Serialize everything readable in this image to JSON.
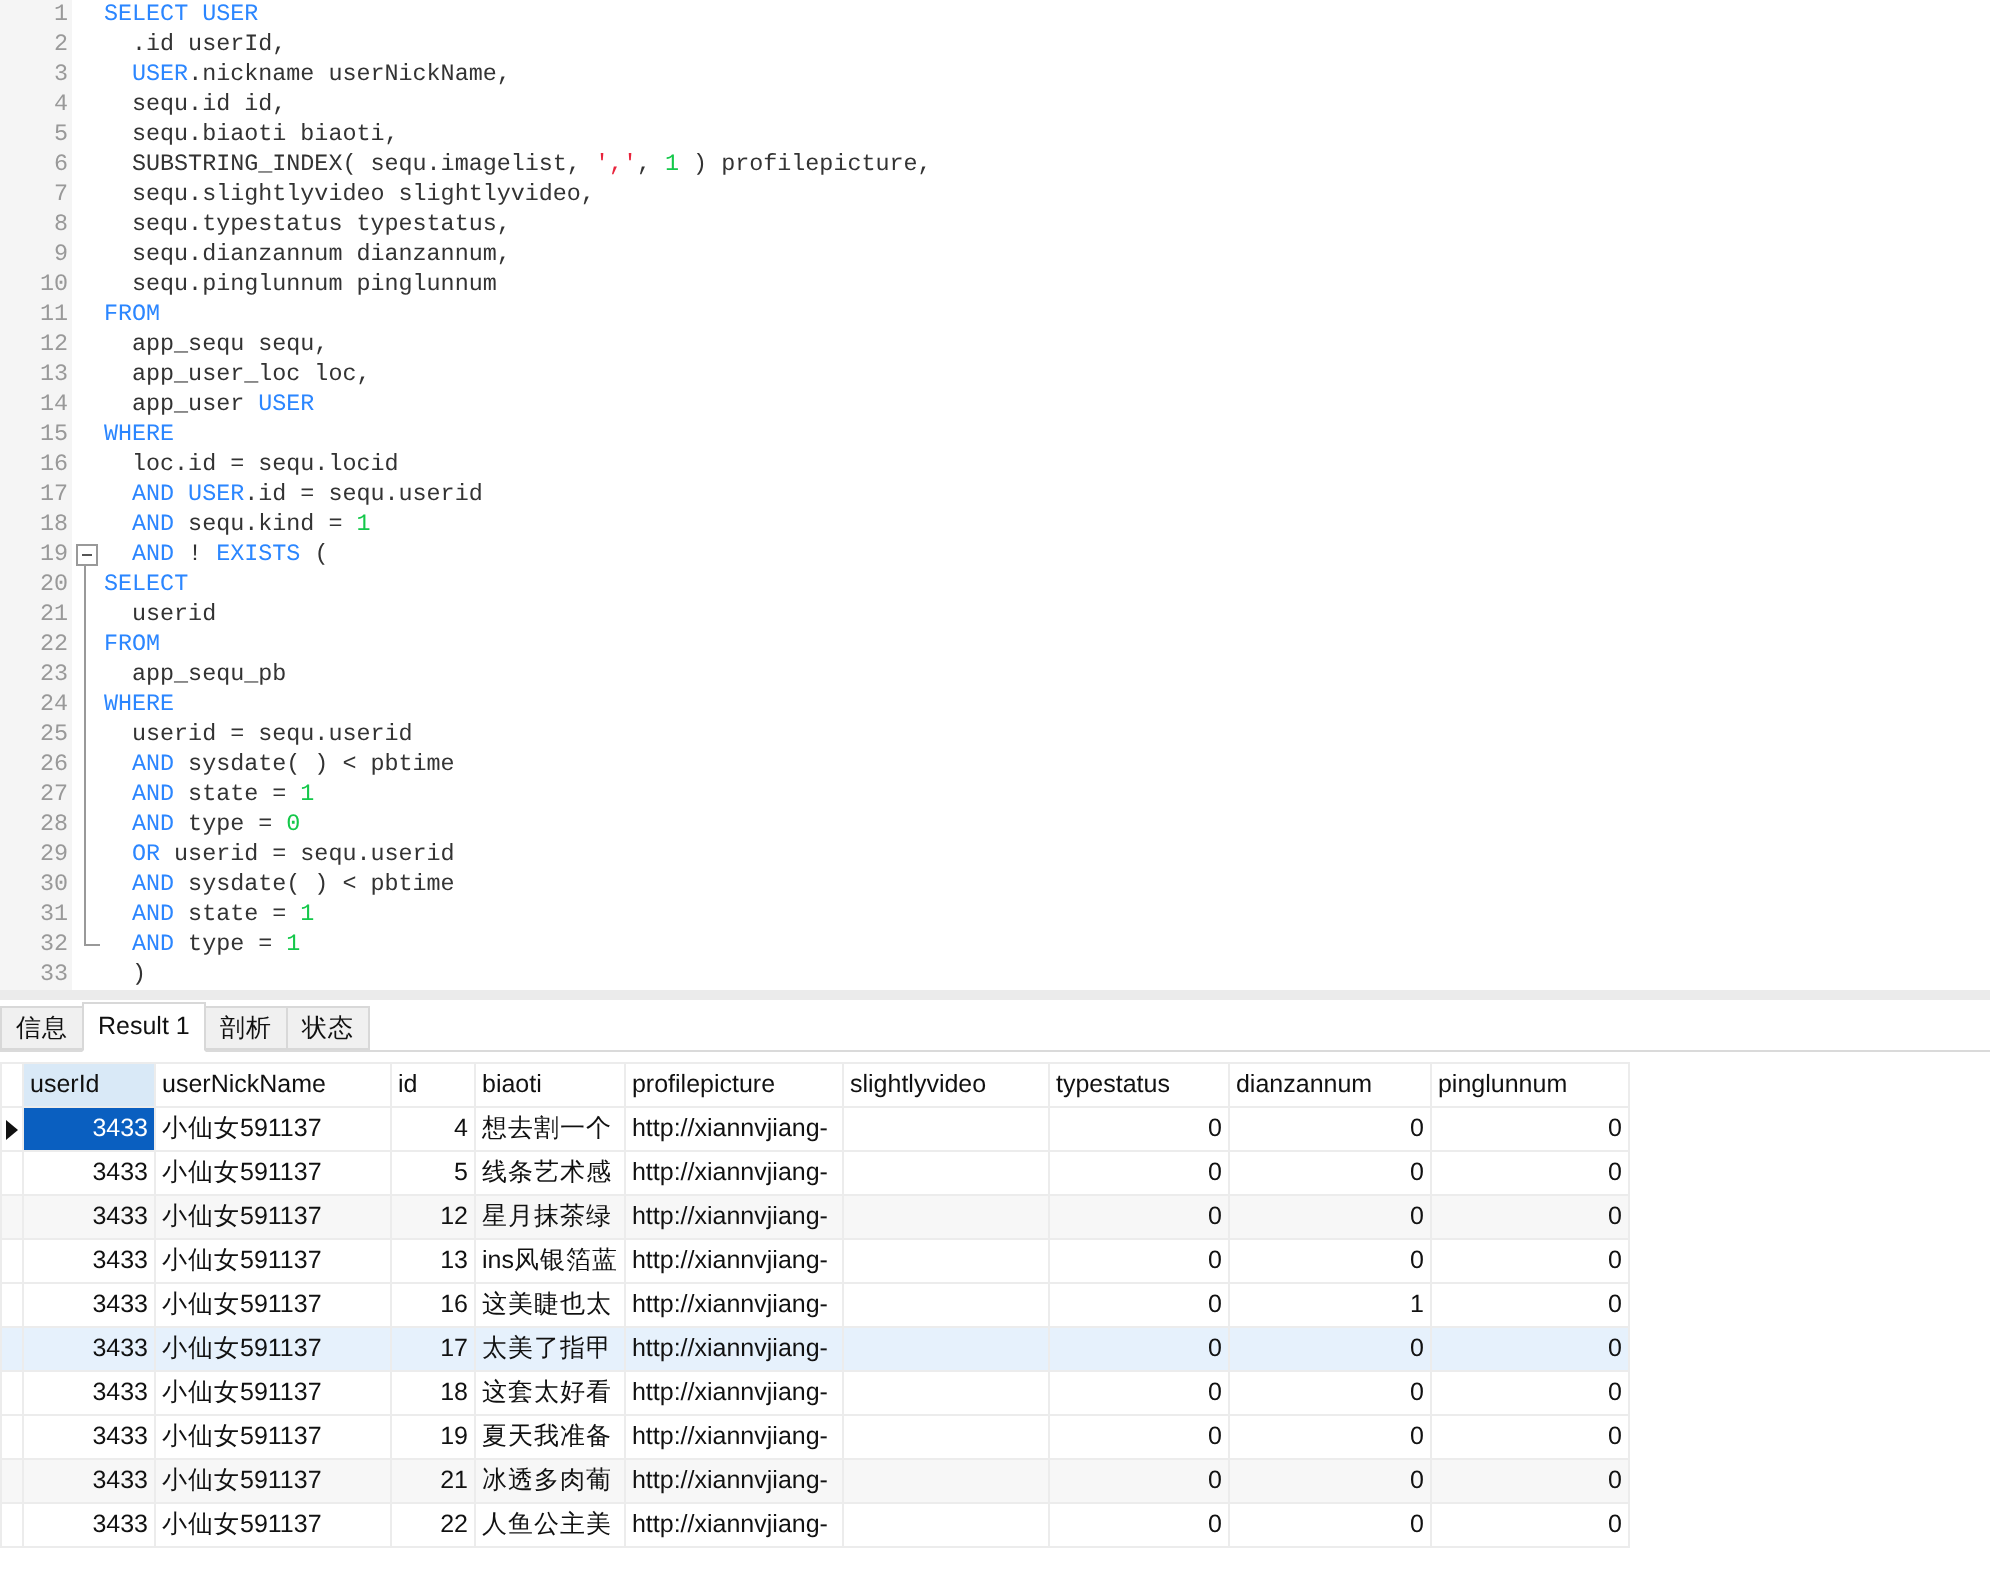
{
  "editor": {
    "lines": [
      {
        "number": "1",
        "indented": false,
        "tokens": [
          {
            "kind": "kw",
            "text": "SELECT USER"
          }
        ]
      },
      {
        "number": "2",
        "indented": true,
        "tokens": [
          {
            "kind": "plain",
            "text": ".id userId,"
          }
        ]
      },
      {
        "number": "3",
        "indented": true,
        "tokens": [
          {
            "kind": "kw",
            "text": "USER"
          },
          {
            "kind": "plain",
            "text": ".nickname userNickName,"
          }
        ]
      },
      {
        "number": "4",
        "indented": true,
        "tokens": [
          {
            "kind": "plain",
            "text": "sequ.id id,"
          }
        ]
      },
      {
        "number": "5",
        "indented": true,
        "tokens": [
          {
            "kind": "plain",
            "text": "sequ.biaoti biaoti,"
          }
        ]
      },
      {
        "number": "6",
        "indented": true,
        "tokens": [
          {
            "kind": "plain",
            "text": "SUBSTRING_INDEX( sequ.imagelist, "
          },
          {
            "kind": "str",
            "text": "','"
          },
          {
            "kind": "plain",
            "text": ", "
          },
          {
            "kind": "num",
            "text": "1"
          },
          {
            "kind": "plain",
            "text": " ) profilepicture,"
          }
        ]
      },
      {
        "number": "7",
        "indented": true,
        "tokens": [
          {
            "kind": "plain",
            "text": "sequ.slightlyvideo slightlyvideo,"
          }
        ]
      },
      {
        "number": "8",
        "indented": true,
        "tokens": [
          {
            "kind": "plain",
            "text": "sequ.typestatus typestatus,"
          }
        ]
      },
      {
        "number": "9",
        "indented": true,
        "tokens": [
          {
            "kind": "plain",
            "text": "sequ.dianzannum dianzannum,"
          }
        ]
      },
      {
        "number": "10",
        "indented": true,
        "tokens": [
          {
            "kind": "plain",
            "text": "sequ.pinglunnum pinglunnum"
          }
        ]
      },
      {
        "number": "11",
        "indented": false,
        "tokens": [
          {
            "kind": "kw",
            "text": "FROM"
          }
        ]
      },
      {
        "number": "12",
        "indented": true,
        "tokens": [
          {
            "kind": "plain",
            "text": "app_sequ sequ,"
          }
        ]
      },
      {
        "number": "13",
        "indented": true,
        "tokens": [
          {
            "kind": "plain",
            "text": "app_user_loc loc,"
          }
        ]
      },
      {
        "number": "14",
        "indented": true,
        "tokens": [
          {
            "kind": "plain",
            "text": "app_user "
          },
          {
            "kind": "kw",
            "text": "USER"
          }
        ]
      },
      {
        "number": "15",
        "indented": false,
        "tokens": [
          {
            "kind": "kw",
            "text": "WHERE"
          }
        ]
      },
      {
        "number": "16",
        "indented": true,
        "tokens": [
          {
            "kind": "plain",
            "text": "loc.id = sequ.locid"
          }
        ]
      },
      {
        "number": "17",
        "indented": true,
        "tokens": [
          {
            "kind": "kw",
            "text": "AND USER"
          },
          {
            "kind": "plain",
            "text": ".id = sequ.userid"
          }
        ]
      },
      {
        "number": "18",
        "indented": true,
        "tokens": [
          {
            "kind": "kw",
            "text": "AND"
          },
          {
            "kind": "plain",
            "text": " sequ.kind = "
          },
          {
            "kind": "num",
            "text": "1"
          }
        ]
      },
      {
        "number": "19",
        "indented": true,
        "fold_start": true,
        "expanded": true,
        "tokens": [
          {
            "kind": "kw",
            "text": "AND"
          },
          {
            "kind": "plain",
            "text": " ! "
          },
          {
            "kind": "kw",
            "text": "EXISTS"
          },
          {
            "kind": "plain",
            "text": " ("
          }
        ]
      },
      {
        "number": "20",
        "indented": false,
        "tokens": [
          {
            "kind": "kw",
            "text": "SELECT"
          }
        ]
      },
      {
        "number": "21",
        "indented": true,
        "tokens": [
          {
            "kind": "plain",
            "text": "userid"
          }
        ]
      },
      {
        "number": "22",
        "indented": false,
        "tokens": [
          {
            "kind": "kw",
            "text": "FROM"
          }
        ]
      },
      {
        "number": "23",
        "indented": true,
        "tokens": [
          {
            "kind": "plain",
            "text": "app_sequ_pb"
          }
        ]
      },
      {
        "number": "24",
        "indented": false,
        "tokens": [
          {
            "kind": "kw",
            "text": "WHERE"
          }
        ]
      },
      {
        "number": "25",
        "indented": true,
        "tokens": [
          {
            "kind": "plain",
            "text": "userid = sequ.userid"
          }
        ]
      },
      {
        "number": "26",
        "indented": true,
        "tokens": [
          {
            "kind": "kw",
            "text": "AND"
          },
          {
            "kind": "plain",
            "text": " sysdate( ) < pbtime"
          }
        ]
      },
      {
        "number": "27",
        "indented": true,
        "tokens": [
          {
            "kind": "kw",
            "text": "AND"
          },
          {
            "kind": "plain",
            "text": " state = "
          },
          {
            "kind": "num",
            "text": "1"
          }
        ]
      },
      {
        "number": "28",
        "indented": true,
        "tokens": [
          {
            "kind": "kw",
            "text": "AND"
          },
          {
            "kind": "plain",
            "text": " type = "
          },
          {
            "kind": "num",
            "text": "0"
          }
        ]
      },
      {
        "number": "29",
        "indented": true,
        "tokens": [
          {
            "kind": "kw",
            "text": "OR"
          },
          {
            "kind": "plain",
            "text": " userid = sequ.userid"
          }
        ]
      },
      {
        "number": "30",
        "indented": true,
        "tokens": [
          {
            "kind": "kw",
            "text": "AND"
          },
          {
            "kind": "plain",
            "text": " sysdate( ) < pbtime"
          }
        ]
      },
      {
        "number": "31",
        "indented": true,
        "tokens": [
          {
            "kind": "kw",
            "text": "AND"
          },
          {
            "kind": "plain",
            "text": " state = "
          },
          {
            "kind": "num",
            "text": "1"
          }
        ]
      },
      {
        "number": "32",
        "indented": true,
        "fold_end": true,
        "tokens": [
          {
            "kind": "kw",
            "text": "AND"
          },
          {
            "kind": "plain",
            "text": " type = "
          },
          {
            "kind": "num",
            "text": "1"
          }
        ]
      },
      {
        "number": "33",
        "indented": true,
        "tokens": [
          {
            "kind": "plain",
            "text": ")"
          }
        ]
      }
    ]
  },
  "result_tabs": [
    {
      "label": "信息",
      "selected": false
    },
    {
      "label": "Result 1",
      "selected": true
    },
    {
      "label": "剖析",
      "selected": false
    },
    {
      "label": "状态",
      "selected": false
    }
  ],
  "grid": {
    "columns": [
      {
        "label": "userId",
        "kind": "number",
        "selected": true
      },
      {
        "label": "userNickName",
        "kind": "text",
        "selected": false
      },
      {
        "label": "id",
        "kind": "number",
        "selected": false
      },
      {
        "label": "biaoti",
        "kind": "text",
        "selected": false
      },
      {
        "label": "profilepicture",
        "kind": "text",
        "selected": false
      },
      {
        "label": "slightlyvideo",
        "kind": "text",
        "selected": false
      },
      {
        "label": "typestatus",
        "kind": "number",
        "selected": false
      },
      {
        "label": "dianzannum",
        "kind": "number",
        "selected": false
      },
      {
        "label": "pinglunnum",
        "kind": "number",
        "selected": false
      }
    ],
    "rows": [
      {
        "selected": true,
        "hovered": false,
        "cells": [
          "3433",
          "小仙女591137",
          "4",
          "想去割一个",
          "http://xiannvjiang-",
          null,
          "0",
          "0",
          "0"
        ]
      },
      {
        "selected": false,
        "hovered": false,
        "cells": [
          "3433",
          "小仙女591137",
          "5",
          "线条艺术感",
          "http://xiannvjiang-",
          null,
          "0",
          "0",
          "0"
        ]
      },
      {
        "selected": false,
        "hovered": false,
        "cells": [
          "3433",
          "小仙女591137",
          "12",
          "星月抹茶绿",
          "http://xiannvjiang-",
          null,
          "0",
          "0",
          "0"
        ]
      },
      {
        "selected": false,
        "hovered": false,
        "cells": [
          "3433",
          "小仙女591137",
          "13",
          "ins风银箔蓝",
          "http://xiannvjiang-",
          null,
          "0",
          "0",
          "0"
        ]
      },
      {
        "selected": false,
        "hovered": false,
        "cells": [
          "3433",
          "小仙女591137",
          "16",
          "这美睫也太",
          "http://xiannvjiang-",
          null,
          "0",
          "1",
          "0"
        ]
      },
      {
        "selected": false,
        "hovered": true,
        "cells": [
          "3433",
          "小仙女591137",
          "17",
          "太美了指甲",
          "http://xiannvjiang-",
          null,
          "0",
          "0",
          "0"
        ]
      },
      {
        "selected": false,
        "hovered": false,
        "cells": [
          "3433",
          "小仙女591137",
          "18",
          "这套太好看",
          "http://xiannvjiang-",
          null,
          "0",
          "0",
          "0"
        ]
      },
      {
        "selected": false,
        "hovered": false,
        "cells": [
          "3433",
          "小仙女591137",
          "19",
          "夏天我准备",
          "http://xiannvjiang-",
          null,
          "0",
          "0",
          "0"
        ]
      },
      {
        "selected": false,
        "hovered": false,
        "cells": [
          "3433",
          "小仙女591137",
          "21",
          "冰透多肉葡",
          "http://xiannvjiang-",
          null,
          "0",
          "0",
          "0"
        ]
      },
      {
        "selected": false,
        "hovered": false,
        "cells": [
          "3433",
          "小仙女591137",
          "22",
          "人鱼公主美",
          "http://xiannvjiang-",
          null,
          "0",
          "0",
          "0"
        ]
      }
    ]
  }
}
